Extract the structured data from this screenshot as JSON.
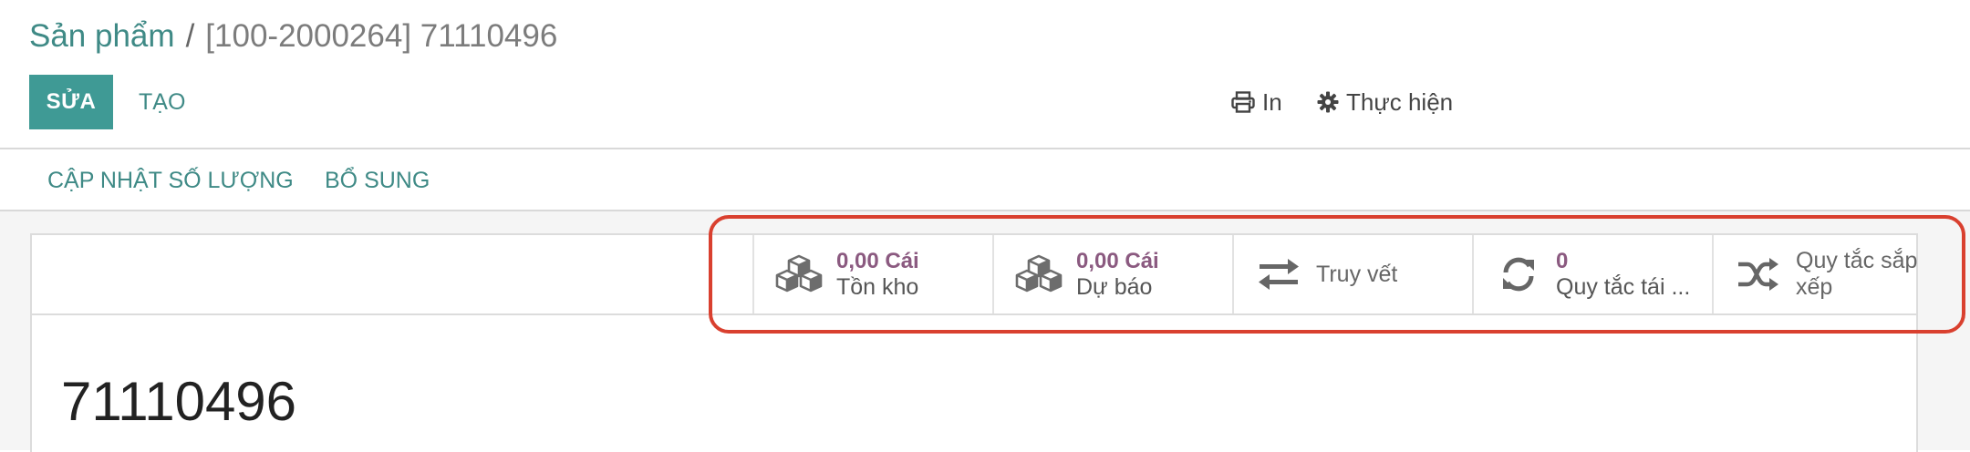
{
  "breadcrumb": {
    "parent": "Sản phẩm",
    "separator": "/",
    "current": "[100-2000264] 71110496"
  },
  "toolbar": {
    "edit_label": "SỬA",
    "create_label": "TẠO",
    "print_label": "In",
    "action_label": "Thực hiện"
  },
  "header_buttons": [
    "CẬP NHẬT SỐ LƯỢNG",
    "BỔ SUNG"
  ],
  "stat_buttons": [
    {
      "icon": "cubes-icon",
      "value": "0,00 Cái",
      "label": "Tồn kho"
    },
    {
      "icon": "cubes-icon",
      "value": "0,00 Cái",
      "label": "Dự báo"
    },
    {
      "icon": "exchange-icon",
      "label": "Truy vết"
    },
    {
      "icon": "refresh-icon",
      "value": "0",
      "label": "Quy tắc tái ..."
    },
    {
      "icon": "random-icon",
      "label_line1": "Quy tắc sắp",
      "label_line2": "xếp"
    }
  ],
  "product": {
    "name": "71110496"
  },
  "colors": {
    "primary": "#3f9a95",
    "link": "#3f8a86",
    "stat_value": "#8b5a80",
    "highlight": "#d9402f"
  }
}
